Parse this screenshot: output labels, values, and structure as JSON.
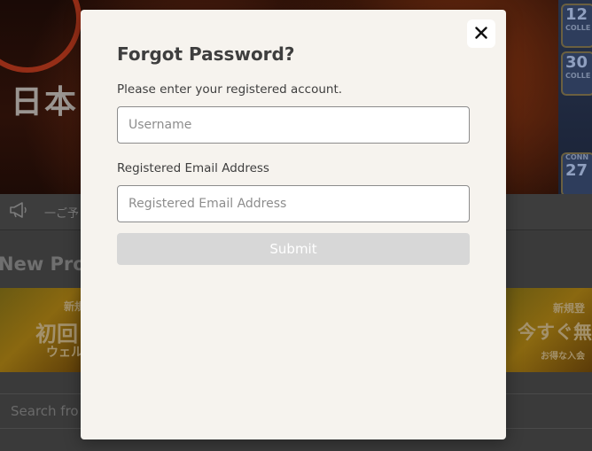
{
  "background": {
    "hero_title": "日本",
    "slot_badges": [
      {
        "number": "12",
        "caption": "COLLE"
      },
      {
        "number": "30",
        "caption": "COLLE"
      },
      {
        "number": "27",
        "caption": "CONN"
      }
    ],
    "ticker_text": "一ご予",
    "section_title": "New Pro",
    "promo_left": {
      "line1": "新規",
      "line2": "初回",
      "line3": "ウェル"
    },
    "promo_right": {
      "line1": "新規登",
      "line2": "今すぐ無",
      "line3": "お得な入会"
    },
    "search_placeholder": "Search fro"
  },
  "modal": {
    "close_label": "×",
    "title": "Forgot Password?",
    "account_label": "Please enter your registered account.",
    "username_placeholder": "Username",
    "username_value": "",
    "email_label": "Registered Email Address",
    "email_placeholder": "Registered Email Address",
    "email_value": "",
    "submit_label": "Submit"
  },
  "icons": {
    "close": "close-icon",
    "megaphone": "megaphone-icon"
  },
  "colors": {
    "modal_bg": "#f6f3ee",
    "submit_disabled": "#d7d7d7",
    "overlay_dim": "#3a3a3a"
  }
}
